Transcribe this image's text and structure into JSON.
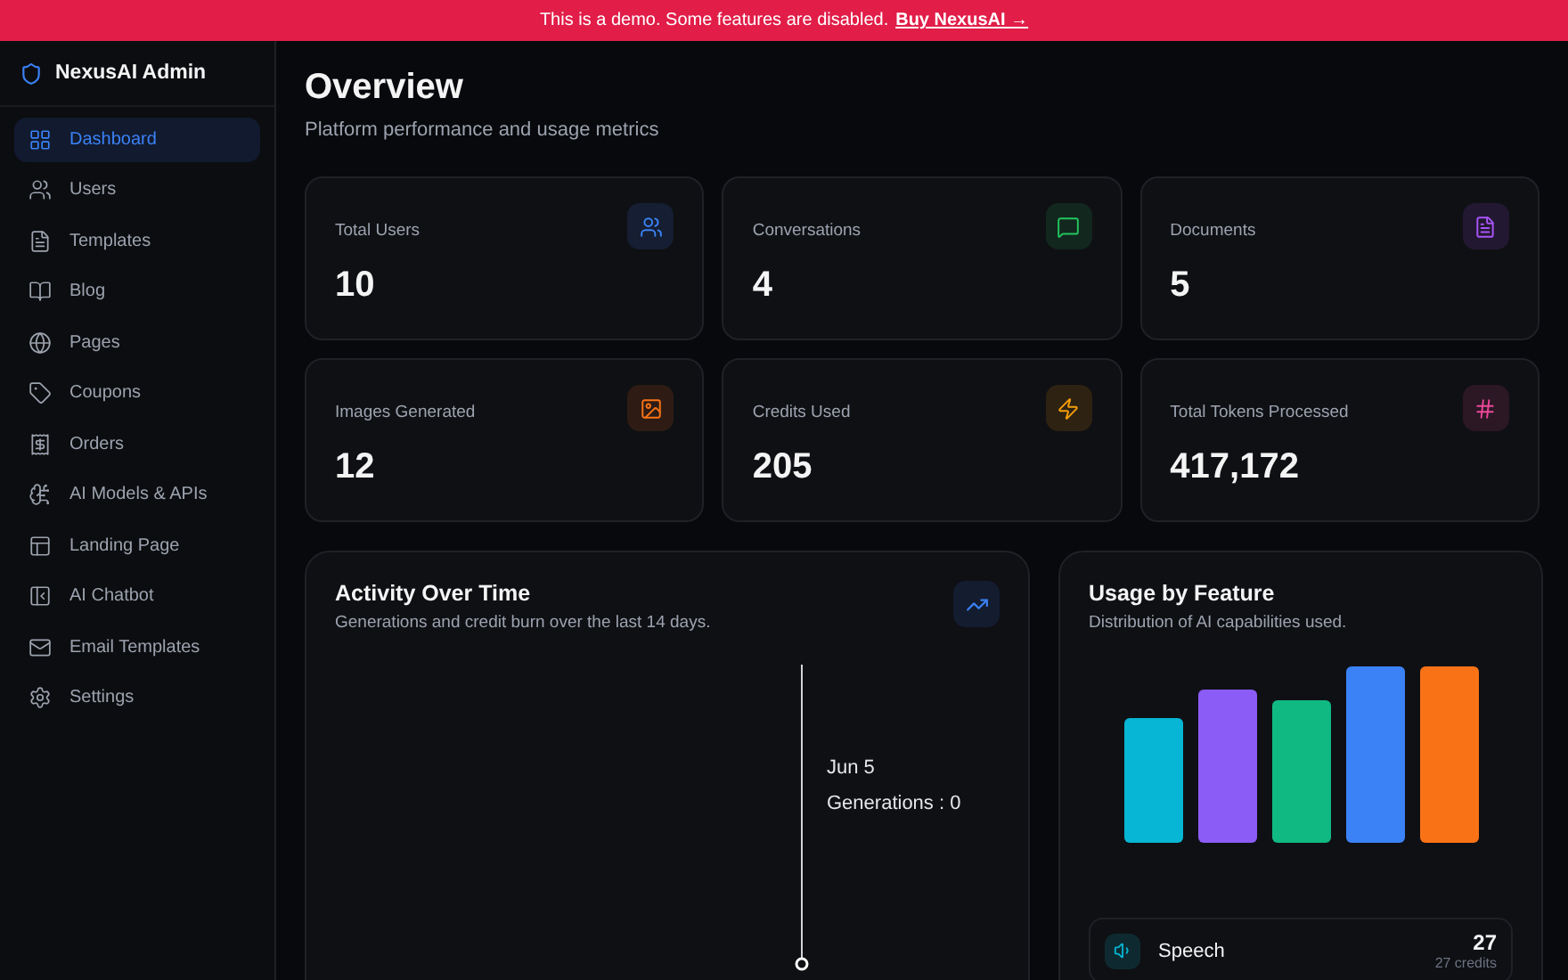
{
  "banner": {
    "text": "This is a demo. Some features are disabled.",
    "link": "Buy NexusAI →"
  },
  "sidebar": {
    "brand": "NexusAI Admin",
    "items": [
      {
        "label": "Dashboard",
        "kind": "grid",
        "selected": true
      },
      {
        "label": "Users",
        "kind": "users",
        "selected": false
      },
      {
        "label": "Templates",
        "kind": "file",
        "selected": false
      },
      {
        "label": "Blog",
        "kind": "book",
        "selected": false
      },
      {
        "label": "Pages",
        "kind": "globe",
        "selected": false
      },
      {
        "label": "Coupons",
        "kind": "tag",
        "selected": false
      },
      {
        "label": "Orders",
        "kind": "receipt",
        "selected": false
      },
      {
        "label": "AI Models & APIs",
        "kind": "brain",
        "selected": false
      },
      {
        "label": "Landing Page",
        "kind": "layout",
        "selected": false
      },
      {
        "label": "AI Chatbot",
        "kind": "panel",
        "selected": false
      },
      {
        "label": "Email Templates",
        "kind": "mail",
        "selected": false
      },
      {
        "label": "Settings",
        "kind": "gear",
        "selected": false
      }
    ]
  },
  "header": {
    "title": "Overview",
    "subtitle": "Platform performance and usage metrics"
  },
  "stats": [
    {
      "label": "Total Users",
      "value": "10",
      "kind": "users",
      "color": "#3b82f6"
    },
    {
      "label": "Conversations",
      "value": "4",
      "kind": "chat",
      "color": "#22c55e"
    },
    {
      "label": "Documents",
      "value": "5",
      "kind": "file",
      "color": "#a855f7"
    },
    {
      "label": "Images Generated",
      "value": "12",
      "kind": "image",
      "color": "#f97316"
    },
    {
      "label": "Credits Used",
      "value": "205",
      "kind": "zap",
      "color": "#f59e0b"
    },
    {
      "label": "Total Tokens Processed",
      "value": "417,172",
      "kind": "hash",
      "color": "#ec4899"
    }
  ],
  "activity": {
    "title": "Activity Over Time",
    "subtitle": "Generations and credit burn over the last 14 days.",
    "tooltip": {
      "date": "Jun 5",
      "reading": "Generations : 0"
    }
  },
  "usage": {
    "title": "Usage by Feature",
    "subtitle": "Distribution of AI capabilities used.",
    "features": [
      {
        "name": "Speech",
        "value": "27",
        "credits": "27 credits"
      }
    ]
  }
}
